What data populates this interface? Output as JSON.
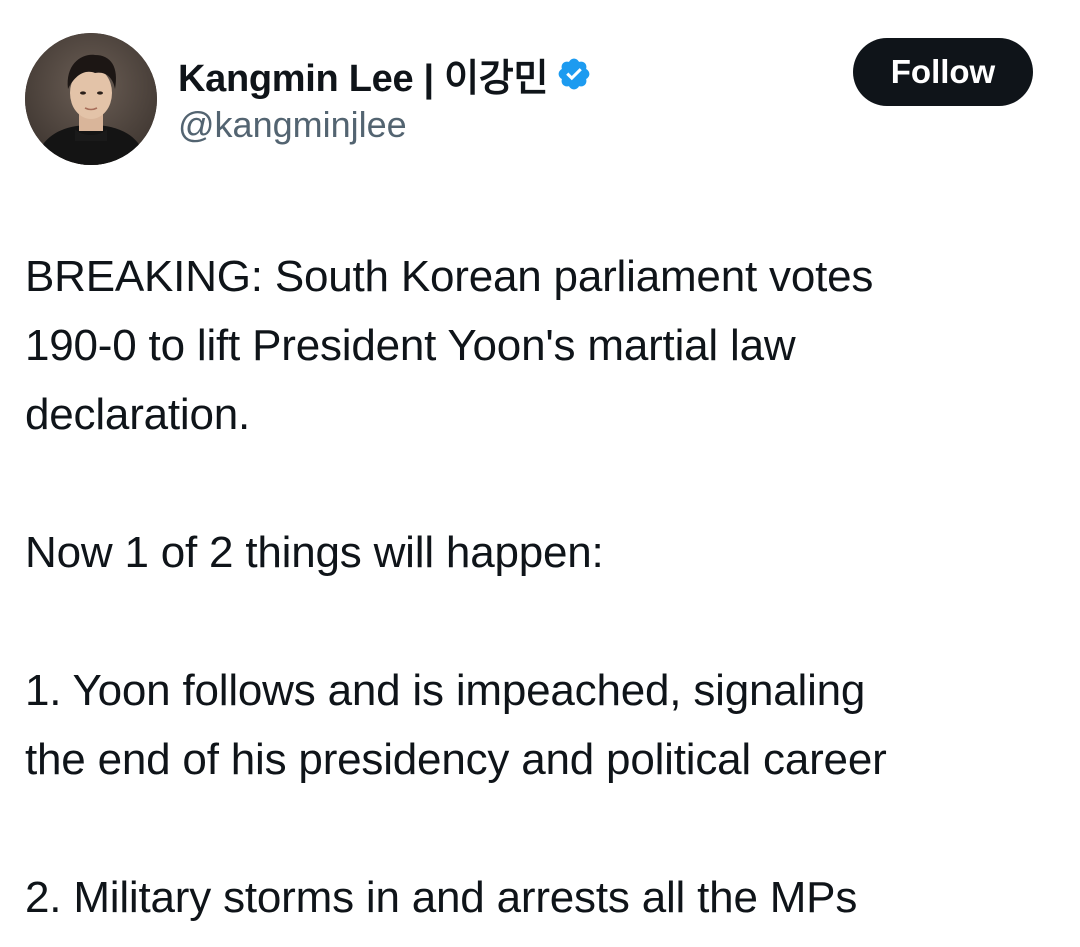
{
  "author": {
    "display_name": "Kangmin Lee | 이강민",
    "handle": "@kangminjlee",
    "verified": true,
    "avatar_icon": "profile-photo",
    "verified_icon": "verified-badge-icon"
  },
  "follow_button": {
    "label": "Follow"
  },
  "tweet": {
    "paragraphs": [
      "BREAKING: South Korean parliament votes\n190-0 to lift President Yoon's martial law\ndeclaration.",
      "Now 1 of 2 things will happen:",
      "1. Yoon follows and is impeached, signaling\nthe end of his presidency and political career",
      "2. Military storms in and arrests all the MPs"
    ]
  },
  "colors": {
    "text_primary": "#0f1419",
    "text_secondary": "#536471",
    "verified_blue": "#1d9bf0",
    "button_bg": "#0f1419",
    "background": "#ffffff"
  }
}
